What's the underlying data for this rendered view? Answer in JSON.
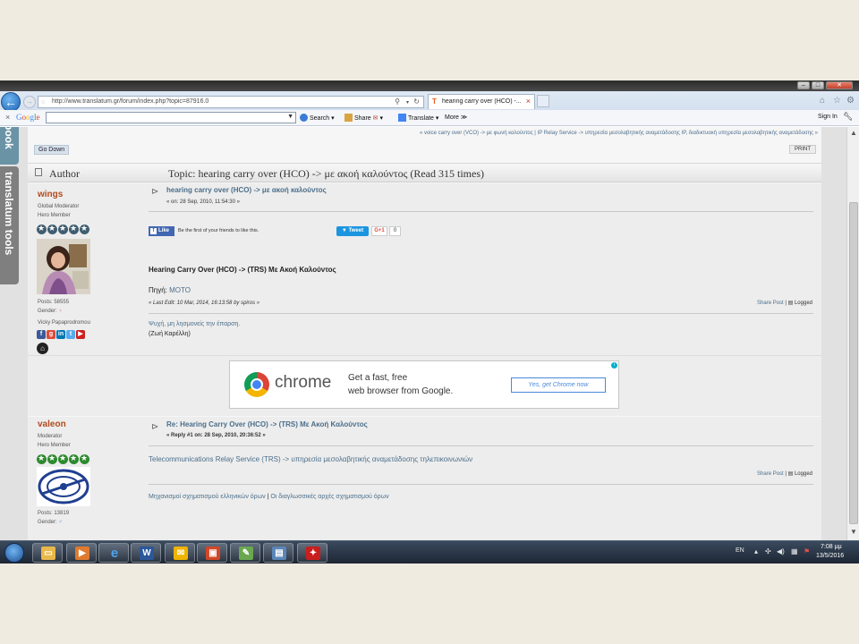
{
  "browser": {
    "url": "http://www.translatum.gr/forum/index.php?topic=87916.0",
    "tab_title": "hearing carry over (HCO) -...",
    "tab_favicon": "T",
    "close_tab": "×"
  },
  "toolbar": {
    "close": "×",
    "google_logo": "Google",
    "search_label": "Search",
    "share_label": "Share",
    "translate_label": "Translate",
    "more_label": "More ≫",
    "signin_label": "Sign In"
  },
  "sidebar": {
    "facebook_label": "book",
    "tools_label": "translatum tools"
  },
  "forum": {
    "breadcrumb": "« voice carry over (VCO) -> με φωνή καλούντος | IP Relay Service -> υπηρεσία μεσολαβητικής αναμετάδοσης IP, διαδικτυακή υπηρεσία μεσολαβητικής αναμετάδοσης »",
    "go_down": "Go Down",
    "print": "PRINT",
    "author_header": "Author",
    "topic_header": "Topic: hearing carry over (HCO) -> με ακοή καλούντος  (Read 315 times)"
  },
  "posts": [
    {
      "name": "wings",
      "role": "Global Moderator",
      "rank": "Hero Member",
      "posts": "Posts: 58555",
      "gender": "Gender:",
      "real_name": "Vicky Papaprodromou",
      "title": "hearing carry over (HCO) -> με ακοή καλούντος",
      "date": "« on: 28 Sep, 2010, 11:54:30 »",
      "like_label": "Like",
      "like_text": "Be the first of your friends to like this.",
      "tweet_label": "Tweet",
      "gplus_label": "G+1",
      "gplus_count": "0",
      "body_bold": "Hearing Carry Over (HCO) -> (TRS) Με Ακοή Καλούντος",
      "source_label": "Πηγή:",
      "source_link": "MOTO",
      "last_edit": "« Last Edit: 10 Mar, 2014, 16:13:58 by spiros »",
      "share_post": "Share Post",
      "logged": "Logged",
      "sig_line1": "Ψυχή, μη λησμονείς την έπαρση.",
      "sig_line2": "(Ζωή Καρέλλη)"
    },
    {
      "name": "valeon",
      "role": "Moderator",
      "rank": "Hero Member",
      "posts": "Posts: 13819",
      "gender": "Gender:",
      "title": "Re: Hearing Carry Over (HCO) -> (TRS) Με Ακοή Καλούντος",
      "date": "« Reply #1 on: 28 Sep, 2010, 20:36:52 »",
      "body_link": "Telecommunications Relay Service (TRS) -> υπηρεσία μεσολαβητικής αναμετάδοσης τηλεπικοινωνιών",
      "share_post": "Share Post",
      "logged": "Logged",
      "sig_link1": "Μηχανισμοί σχηματισμού ελληνικών όρων",
      "sig_sep": "|",
      "sig_link2": "Οι διαγλωσσικές αρχές σχηματισμού όρων"
    }
  ],
  "ad": {
    "brand": "chrome",
    "line1": "Get a fast, free",
    "line2": "web browser from Google.",
    "cta": "Yes, get Chrome now"
  },
  "taskbar": {
    "language": "EN",
    "time": "7:08 μμ",
    "date": "13/5/2016"
  },
  "colors": {
    "accent_link": "#4a6e8a",
    "poster_name": "#b24a1d",
    "star_wings": "#3f5d70",
    "star_valeon": "#2e8a2e"
  }
}
